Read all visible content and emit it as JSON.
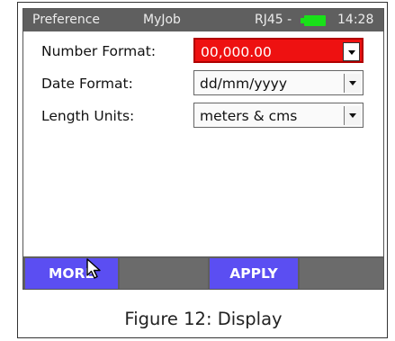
{
  "status_bar": {
    "preference": "Preference",
    "job": "MyJob",
    "port": "RJ45 -",
    "time": "14:28",
    "battery_color": "#19e019"
  },
  "settings": [
    {
      "label": "Number Format:",
      "value": "00,000.00",
      "active": true
    },
    {
      "label": "Date Format:",
      "value": "dd/mm/yyyy",
      "active": false
    },
    {
      "label": "Length Units:",
      "value": "meters & cms",
      "active": false
    }
  ],
  "softkeys": {
    "more": "MORE",
    "blank1": "",
    "apply": "APPLY",
    "blank2": "",
    "active_color": "#5b4ef2"
  },
  "caption": "Figure 12: Display",
  "icons": [
    "battery-icon",
    "dropdown-arrow-icon",
    "mouse-pointer-icon"
  ]
}
